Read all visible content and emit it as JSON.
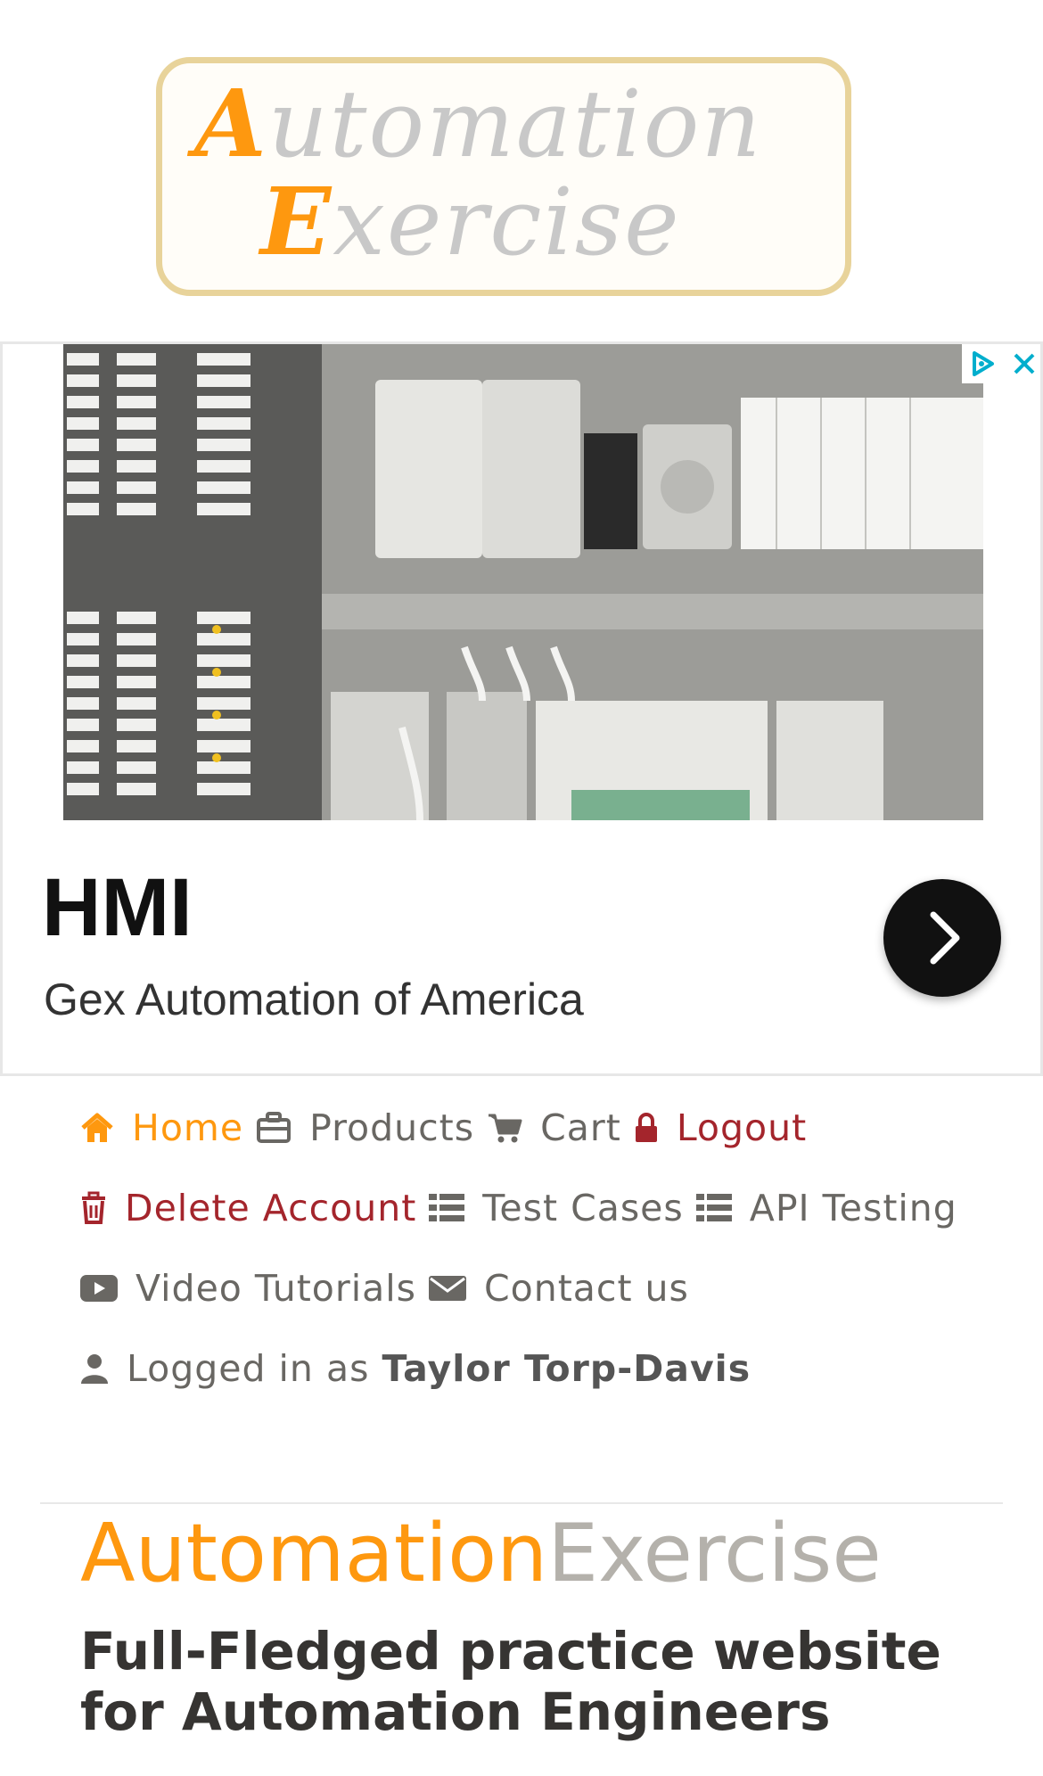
{
  "logo": {
    "line1_cap": "A",
    "line1_rest": "utomation",
    "line2_cap": "E",
    "line2_rest": "xercise"
  },
  "ad": {
    "title": "HMI",
    "subtitle": "Gex Automation of America",
    "badge_icons": [
      "adchoices-icon",
      "close-icon"
    ],
    "arrow_icon": "chevron-right-icon"
  },
  "nav": {
    "row1": [
      {
        "label": "Home",
        "icon": "home-icon"
      },
      {
        "label": "Products",
        "icon": "briefcase-icon"
      },
      {
        "label": "Cart",
        "icon": "shopping-cart-icon"
      },
      {
        "label": "Logout",
        "icon": "lock-icon"
      }
    ],
    "row2": [
      {
        "label": "Delete Account",
        "icon": "trash-icon"
      },
      {
        "label": "Test Cases",
        "icon": "list-icon"
      },
      {
        "label": "API Testing",
        "icon": "list-icon"
      }
    ],
    "row3": [
      {
        "label": "Video Tutorials",
        "icon": "youtube-play-icon"
      },
      {
        "label": "Contact us",
        "icon": "envelope-icon"
      }
    ],
    "logged_in_prefix": "Logged in as",
    "logged_in_user": "Taylor Torp-Davis",
    "user_icon": "user-icon"
  },
  "hero": {
    "brand_part1": "Automation",
    "brand_part2": "Exercise",
    "heading": "Full-Fledged practice website for Automation Engineers"
  },
  "colors": {
    "accent": "#fe980f",
    "danger": "#a4252c",
    "nav_text": "#696763",
    "brand_grey": "#b4b1ab"
  }
}
